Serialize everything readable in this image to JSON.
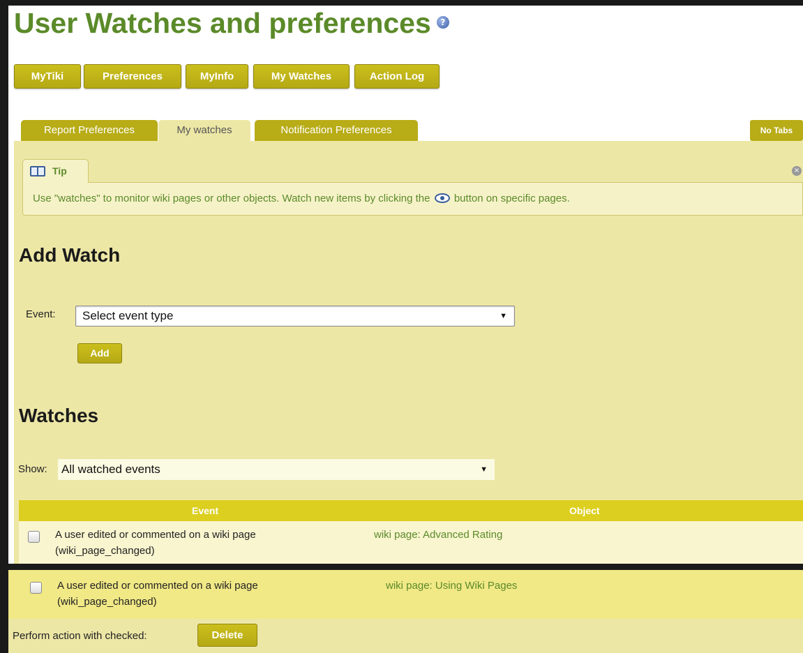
{
  "page": {
    "title": "User Watches and preferences"
  },
  "menu": [
    {
      "label": "MyTiki"
    },
    {
      "label": "Preferences"
    },
    {
      "label": "MyInfo"
    },
    {
      "label": "My Watches"
    },
    {
      "label": "Action Log"
    }
  ],
  "tabs": [
    {
      "label": "Report Preferences",
      "active": false
    },
    {
      "label": "My watches",
      "active": true
    },
    {
      "label": "Notification Preferences",
      "active": false
    }
  ],
  "no_tabs_label": "No Tabs",
  "tip": {
    "label": "Tip",
    "text_before": "Use \"watches\" to monitor wiki pages or other objects. Watch new items by clicking the",
    "text_after": "button on specific pages."
  },
  "add_watch": {
    "heading": "Add Watch",
    "event_label": "Event:",
    "event_selected": "Select event type",
    "add_label": "Add"
  },
  "watches": {
    "heading": "Watches",
    "show_label": "Show:",
    "show_selected": "All watched events",
    "columns": [
      "Event",
      "Object"
    ],
    "rows": [
      {
        "event_line1": "A user edited or commented on a wiki page",
        "event_line2": "(wiki_page_changed)",
        "object": "wiki page: Advanced Rating"
      },
      {
        "event_line1": "A user edited or commented on a wiki page",
        "event_line2": "(wiki_page_changed)",
        "object": "wiki page: Using Wiki Pages"
      }
    ],
    "perform_label": "Perform action with checked:",
    "delete_label": "Delete"
  },
  "colors": {
    "title_green": "#5b8a29",
    "button_olive": "#b8ac17",
    "panel_bg": "#ede7a6",
    "table_header": "#dccf1f"
  }
}
